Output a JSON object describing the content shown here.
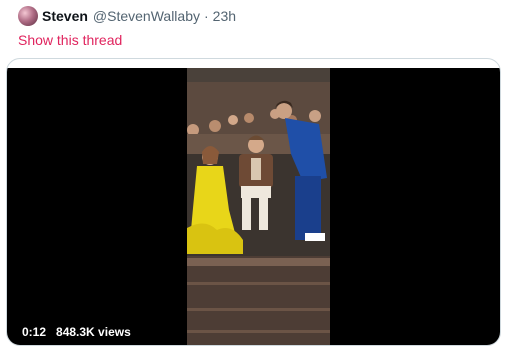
{
  "tweet": {
    "display_name": "Steven",
    "handle": "@StevenWallaby",
    "separator": "·",
    "time": "23h",
    "show_thread": "Show this thread"
  },
  "video": {
    "time": "0:12",
    "views": "848.3K views"
  }
}
